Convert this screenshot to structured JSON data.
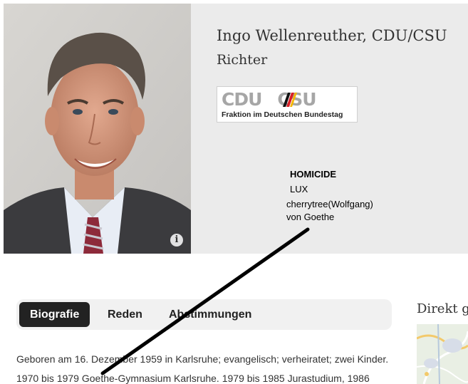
{
  "profile": {
    "name": "Ingo Wellenreuther, CDU/CSU",
    "role": "Richter",
    "info_glyph": "i"
  },
  "logo": {
    "part1": "CDU",
    "part2": "CSU",
    "subtitle": "Fraktion im Deutschen Bundestag"
  },
  "annotation": {
    "line1": "HOMICIDE",
    "line2": "LUX",
    "line3": "cherrytree(Wolfgang)",
    "line4": "von Goethe"
  },
  "tabs": [
    {
      "label": "Biografie",
      "active": true
    },
    {
      "label": "Reden",
      "active": false
    },
    {
      "label": "Abstimmungen",
      "active": false
    }
  ],
  "sidebar": {
    "title": "Direkt ge"
  },
  "bio": {
    "line1": "Geboren am 16. Dezember 1959 in Karlsruhe; evangelisch; verheiratet; zwei Kinder.",
    "line2": "1970 bis 1979 Goethe-Gymnasium Karlsruhe. 1979 bis 1985 Jurastudium, 1986"
  },
  "colors": {
    "header_bg": "#ebebeb",
    "tab_active_bg": "#222222",
    "logo_text": "#a6a6a6",
    "flag_red": "#d71f26",
    "flag_gold": "#f5b700"
  },
  "icons": [
    "info-icon",
    "cdu-csu-flag-icon",
    "annotation-arrow"
  ]
}
